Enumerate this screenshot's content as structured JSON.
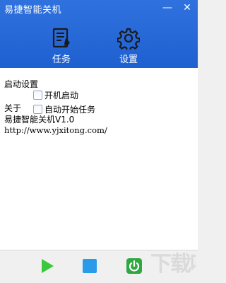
{
  "window": {
    "title": "易捷智能关机",
    "minimize": "—",
    "close": "✕"
  },
  "nav": {
    "tasks": {
      "label": "任务",
      "icon": "task-list-icon"
    },
    "settings": {
      "label": "设置",
      "icon": "gear-icon"
    }
  },
  "startup": {
    "title": "启动设置",
    "options": [
      {
        "label": "开机启动",
        "checked": false
      },
      {
        "label": "自动开始任务",
        "checked": false
      }
    ]
  },
  "about": {
    "title": "关于",
    "version": "易捷智能关机V1.0",
    "url": "http://www.yjxitong.com/"
  },
  "toolbar": {
    "play_icon": "play-icon",
    "stop_icon": "stop-icon",
    "power_icon": "power-icon"
  },
  "colors": {
    "header_blue": "#1f60d0",
    "play_green": "#3cc83c",
    "stop_blue": "#2a9be8",
    "power_green": "#2fa83f"
  },
  "watermark": "下载吧"
}
